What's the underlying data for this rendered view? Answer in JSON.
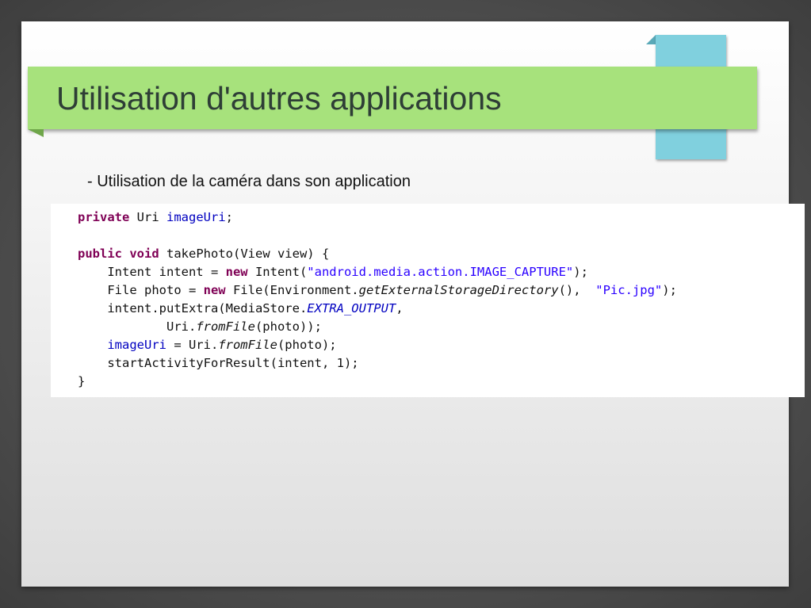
{
  "slide": {
    "title": "Utilisation d'autres applications",
    "bullet": "- Utilisation de la caméra dans son application"
  },
  "code": {
    "language": "java",
    "lines": [
      [
        {
          "t": "private",
          "k": "kw"
        },
        {
          "t": " Uri "
        },
        {
          "t": "imageUri",
          "k": "fld"
        },
        {
          "t": ";"
        }
      ],
      [],
      [
        {
          "t": "public",
          "k": "kw"
        },
        {
          "t": " "
        },
        {
          "t": "void",
          "k": "kw"
        },
        {
          "t": " takePhoto(View view) {"
        }
      ],
      [
        {
          "t": "    Intent intent = "
        },
        {
          "t": "new",
          "k": "kw"
        },
        {
          "t": " Intent("
        },
        {
          "t": "\"android.media.action.IMAGE_CAPTURE\"",
          "k": "str"
        },
        {
          "t": ");"
        }
      ],
      [
        {
          "t": "    File photo = "
        },
        {
          "t": "new",
          "k": "kw"
        },
        {
          "t": " File(Environment."
        },
        {
          "t": "getExternalStorageDirectory",
          "k": "stat"
        },
        {
          "t": "(),  "
        },
        {
          "t": "\"Pic.jpg\"",
          "k": "str"
        },
        {
          "t": ");"
        }
      ],
      [
        {
          "t": "    intent.putExtra(MediaStore."
        },
        {
          "t": "EXTRA_OUTPUT",
          "k": "statfld"
        },
        {
          "t": ","
        }
      ],
      [
        {
          "t": "            Uri."
        },
        {
          "t": "fromFile",
          "k": "stat"
        },
        {
          "t": "(photo));"
        }
      ],
      [
        {
          "t": "    "
        },
        {
          "t": "imageUri",
          "k": "fld"
        },
        {
          "t": " = Uri."
        },
        {
          "t": "fromFile",
          "k": "stat"
        },
        {
          "t": "(photo);"
        }
      ],
      [
        {
          "t": "    startActivityForResult(intent, 1);"
        }
      ],
      [
        {
          "t": "}"
        }
      ]
    ]
  },
  "colors": {
    "title_band": "#a7e27c",
    "accent_block": "#80d0de",
    "keyword": "#7f0055",
    "field": "#0000c0",
    "string": "#2a00ff",
    "background": "#4d4d4d"
  }
}
